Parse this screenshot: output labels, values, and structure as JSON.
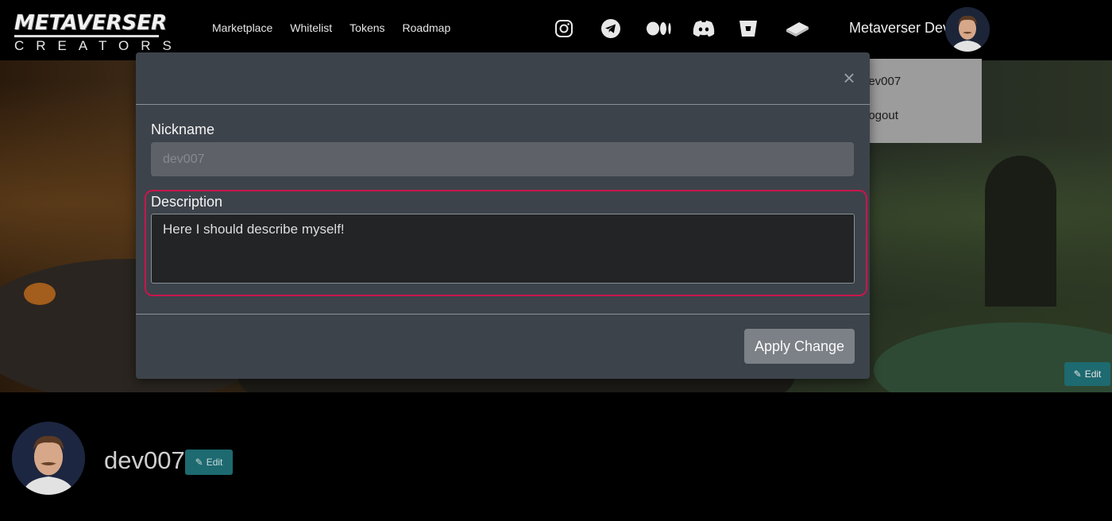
{
  "brand": {
    "top": "METAVERSER",
    "bottom": "CREATORS"
  },
  "nav": {
    "links": [
      "Marketplace",
      "Whitelist",
      "Tokens",
      "Roadmap"
    ]
  },
  "socials": [
    "instagram-icon",
    "telegram-icon",
    "medium-icon",
    "discord-icon",
    "bitbucket-icon",
    "gitbook-icon"
  ],
  "user": {
    "name": "Metaverser Dev"
  },
  "dropdown": {
    "items": [
      "dev007",
      "Logout"
    ]
  },
  "banner": {
    "edit_label": "Edit"
  },
  "profile": {
    "name": "dev007",
    "edit_label": "Edit"
  },
  "modal": {
    "close_label": "×",
    "nickname_label": "Nickname",
    "nickname_placeholder": "dev007",
    "description_label": "Description",
    "description_value": "Here I should describe myself!",
    "apply_label": "Apply Change"
  },
  "colors": {
    "accent_edit": "#1d6a70",
    "focus_ring": "#c8164a",
    "modal_bg": "#3d434b"
  }
}
